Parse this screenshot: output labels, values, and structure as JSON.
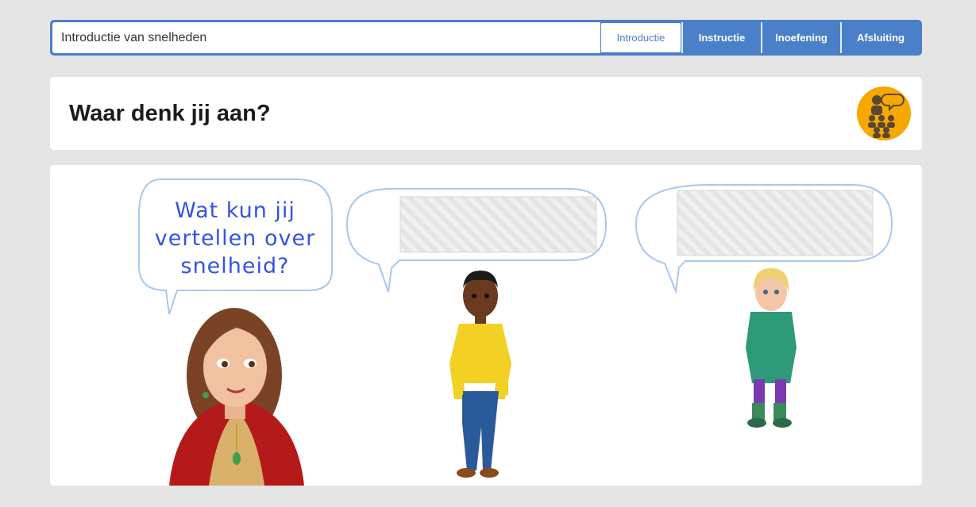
{
  "topbar": {
    "lesson_title": "Introductie van snelheden",
    "tabs": [
      {
        "label": "Introductie",
        "active": true
      },
      {
        "label": "Instructie",
        "active": false
      },
      {
        "label": "Inoefening",
        "active": false
      },
      {
        "label": "Afsluiting",
        "active": false
      }
    ]
  },
  "header": {
    "title": "Waar denk jij aan?",
    "badge_icon": "group-discussion-icon"
  },
  "scene": {
    "teacher_bubble": {
      "line1": "Wat kun jij",
      "line2": "vertellen over",
      "line3": "snelheid?"
    },
    "hidden_answer_placeholders": 2
  },
  "colors": {
    "accent": "#4a80c8",
    "badge": "#f5a800",
    "bubble_text": "#3553e0",
    "background": "#e5e5e5"
  }
}
